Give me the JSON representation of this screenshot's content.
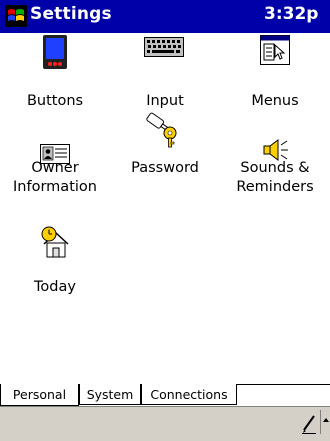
{
  "titlebar": {
    "title": "Settings",
    "time": "3:32p"
  },
  "items": [
    {
      "label": "Buttons"
    },
    {
      "label": "Input"
    },
    {
      "label": "Menus"
    },
    {
      "label_line1": "Owner",
      "label_line2": "Information"
    },
    {
      "label": "Password"
    },
    {
      "label_line1": "Sounds &",
      "label_line2": "Reminders"
    },
    {
      "label": "Today"
    }
  ],
  "tabs": [
    {
      "label": "Personal"
    },
    {
      "label": "System"
    },
    {
      "label": "Connections"
    }
  ],
  "colors": {
    "titlebar": "#0000a8",
    "commandbar": "#d4d0c8"
  }
}
